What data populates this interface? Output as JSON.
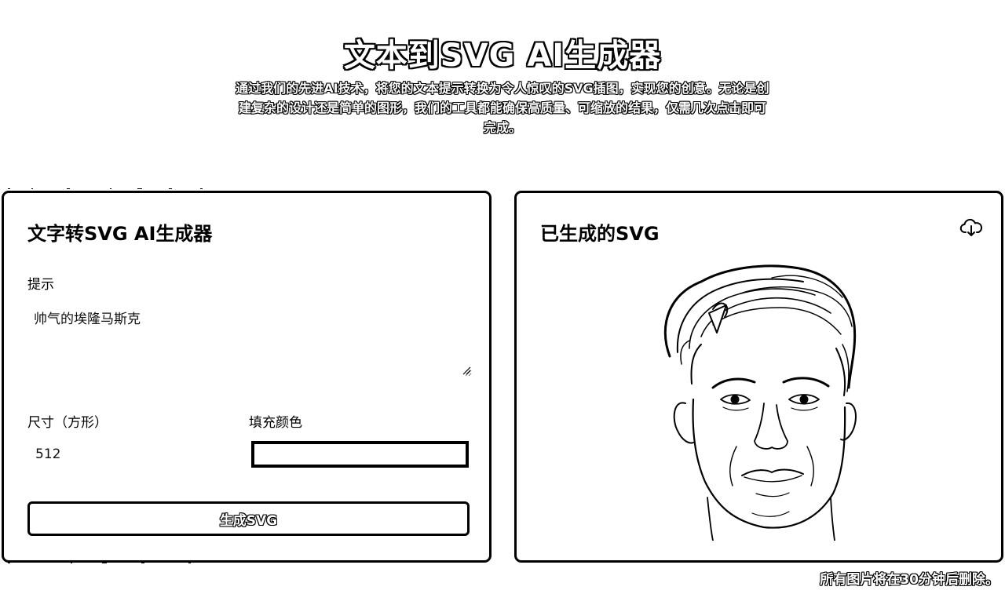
{
  "hero": {
    "title": "文本到SVG AI生成器",
    "description": "通过我们的先进AI技术，将您的文本提示转换为令人惊叹的SVG插图，实现您的创意。无论是创建复杂的设计还是简单的图形，我们的工具都能确保高质量、可缩放的结果，仅需几次点击即可完成。"
  },
  "generator": {
    "title": "文字转SVG AI生成器",
    "prompt_label": "提示",
    "prompt_value": "帅气的埃隆马斯克",
    "size_label": "尺寸（方形）",
    "size_value": "512",
    "color_label": "填充颜色",
    "fill_color": "#ffffff",
    "button_label": "生成SVG"
  },
  "result": {
    "title": "已生成的SVG",
    "download_icon": "cloud-download-icon",
    "image_icon": "portrait-line-art"
  },
  "footer": {
    "note": "所有图片将在30分钟后删除。"
  }
}
